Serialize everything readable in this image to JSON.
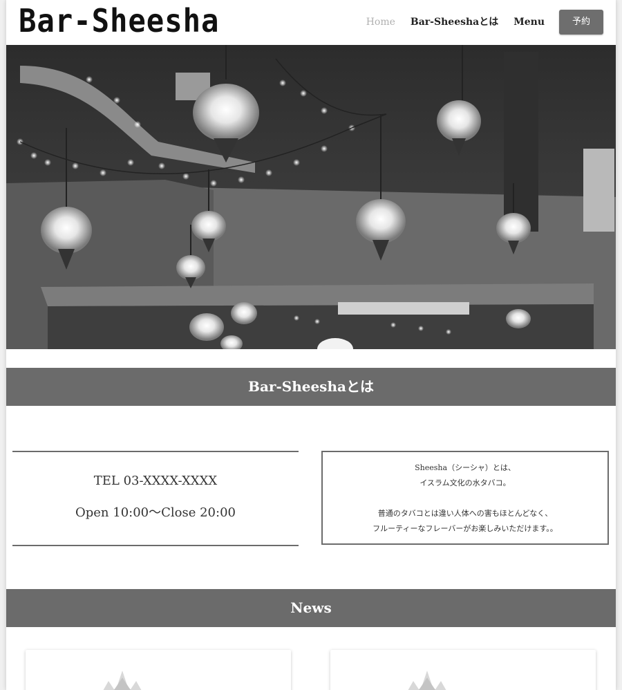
{
  "header": {
    "logo": "Bar-Sheesha",
    "nav": {
      "home": "Home",
      "about": "Bar-Sheeshaとは",
      "menu": "Menu",
      "reserve": "予約"
    }
  },
  "hero": {
    "image": "ceiling-with-hanging-mosaic-lanterns-and-string-lights"
  },
  "about_section": {
    "title": "Bar-Sheeshaとは"
  },
  "info": {
    "tel": "TEL 03-XXXX-XXXX",
    "hours": "Open 10:00〜Close 20:00",
    "description_line1": "Sheesha（シーシャ）とは、",
    "description_line2": "イスラム文化の水タバコ。",
    "description_line3": "普通のタバコとは違い人体への害もほとんどなく、",
    "description_line4": "フルーティーなフレーバーがお楽しみいただけます。。"
  },
  "news_section": {
    "title": "News"
  },
  "colors": {
    "accent": "#6b6b6b",
    "nav_active": "#b0b0b0",
    "text": "#222222"
  }
}
